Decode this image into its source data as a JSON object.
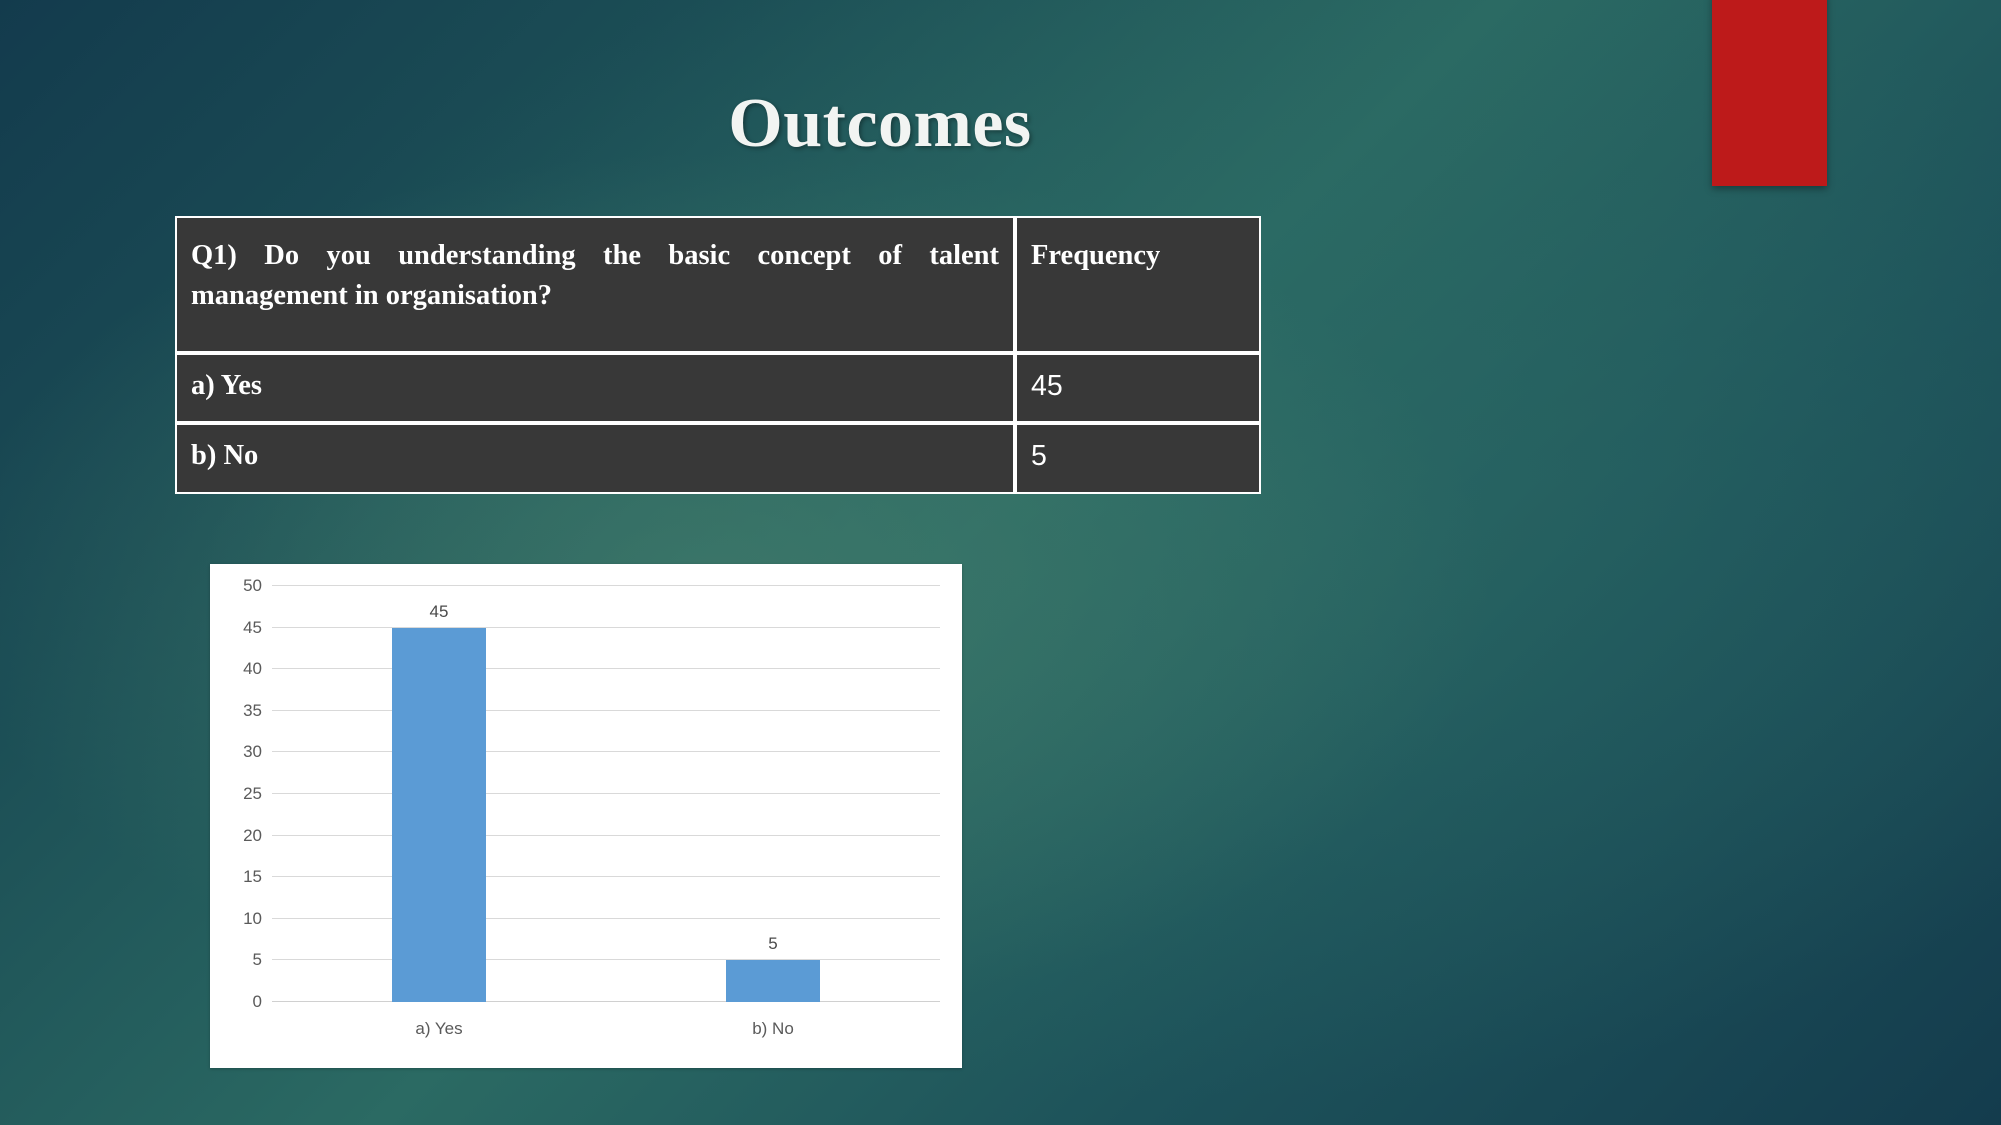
{
  "slide": {
    "title": "Outcomes",
    "accent_red": "#bd1a1a",
    "background_teal": "#2b6a63",
    "table_cell_bg": "#383838",
    "bar_color": "#5b9bd5"
  },
  "table": {
    "header": {
      "question": "Q1) Do you understanding the basic concept of talent management in organisation?",
      "frequency": "Frequency"
    },
    "rows": [
      {
        "option": "a) Yes",
        "frequency": "45"
      },
      {
        "option": "b) No",
        "frequency": "5"
      }
    ]
  },
  "chart_data": {
    "type": "bar",
    "title": "",
    "xlabel": "",
    "ylabel": "",
    "categories": [
      "a) Yes",
      "b) No"
    ],
    "values": [
      45,
      5
    ],
    "data_labels": [
      "45",
      "5"
    ],
    "ylim": [
      0,
      50
    ],
    "yticks": [
      0,
      5,
      10,
      15,
      20,
      25,
      30,
      35,
      40,
      45,
      50
    ],
    "ytick_labels": [
      "0",
      "5",
      "10",
      "15",
      "20",
      "25",
      "30",
      "35",
      "40",
      "45",
      "50"
    ],
    "grid": true,
    "legend": "none",
    "series": [
      {
        "name": "Frequency",
        "values": [
          45,
          5
        ]
      }
    ]
  }
}
